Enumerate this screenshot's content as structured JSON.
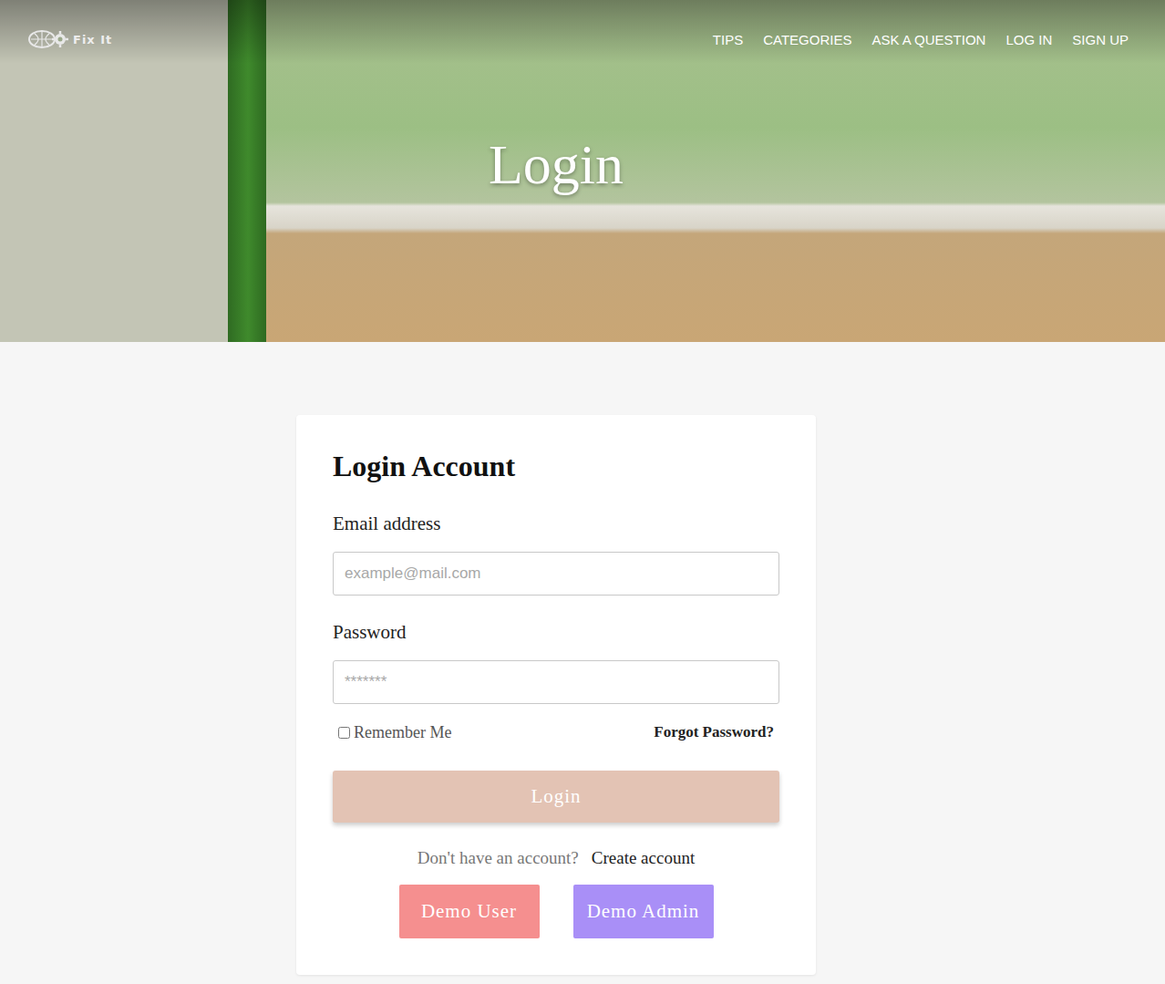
{
  "header": {
    "logo": "Fix It",
    "nav": [
      "TIPS",
      "CATEGORIES",
      "ASK A QUESTION",
      "LOG IN",
      "SIGN UP"
    ],
    "title": "Login"
  },
  "form": {
    "title": "Login Account",
    "fields": [
      {
        "label": "Email address",
        "placeholder": "example@mail.com",
        "kind": "email"
      },
      {
        "label": "Password",
        "placeholder": "*******",
        "kind": "password"
      }
    ],
    "remember": {
      "label": "Remember Me",
      "checked": false
    },
    "forgot": "Forgot Password?",
    "submit": "Login",
    "signup": {
      "prompt": "Don't have an account?",
      "link": "Create account"
    },
    "demo": [
      {
        "label": "Demo User",
        "color": "#f58f8f"
      },
      {
        "label": "Demo Admin",
        "color": "#a98ff7"
      }
    ]
  }
}
